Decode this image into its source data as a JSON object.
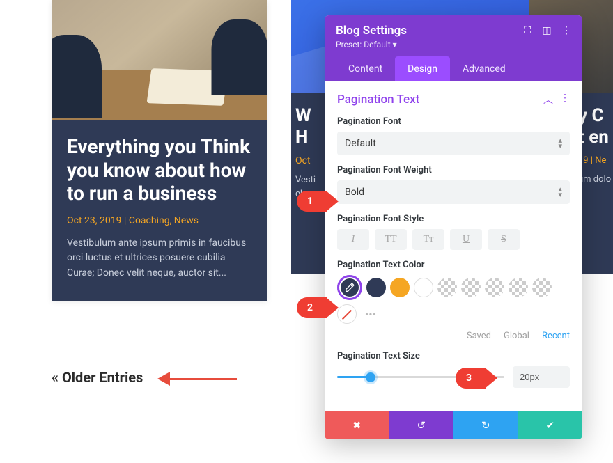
{
  "post": {
    "title": "Everything you Think you know about how to run a business",
    "date": "Oct 23, 2019",
    "sep": " | ",
    "cats": "Coaching, News",
    "excerpt": "Vestibulum ante ipsum primis in faucibus orci luctus et ultrices posuere cubilia Curae; Donec velit neque, auctor sit..."
  },
  "pagination_link": "« Older Entries",
  "peek_mid": {
    "title": "W\nH",
    "meta": "Oct",
    "txt": "Vesti\neleme"
  },
  "peek_right": {
    "title": "y C\nt en",
    "meta": "19 | Ne",
    "txt": "um dolo\ng elit. Nu\nVestibul"
  },
  "panel": {
    "title": "Blog Settings",
    "preset": "Preset: Default ▾",
    "tabs": {
      "content": "Content",
      "design": "Design",
      "advanced": "Advanced"
    },
    "section": "Pagination Text",
    "fields": {
      "font_label": "Pagination Font",
      "font_value": "Default",
      "weight_label": "Pagination Font Weight",
      "weight_value": "Bold",
      "style_label": "Pagination Font Style",
      "style_buttons": {
        "italic": "I",
        "caps": "TT",
        "smallcaps": "Tᴛ",
        "underline": "U",
        "strike": "S"
      },
      "color_label": "Pagination Text Color",
      "size_label": "Pagination Text Size",
      "size_value": "20px"
    },
    "color_tabs": {
      "saved": "Saved",
      "global": "Global",
      "recent": "Recent"
    },
    "colors": {
      "selected": "#2f3a56",
      "preset1": "#2f3a56",
      "preset2": "#f5a623",
      "preset3": "#ffffff"
    }
  },
  "callouts": {
    "one": "1",
    "two": "2",
    "three": "3"
  }
}
